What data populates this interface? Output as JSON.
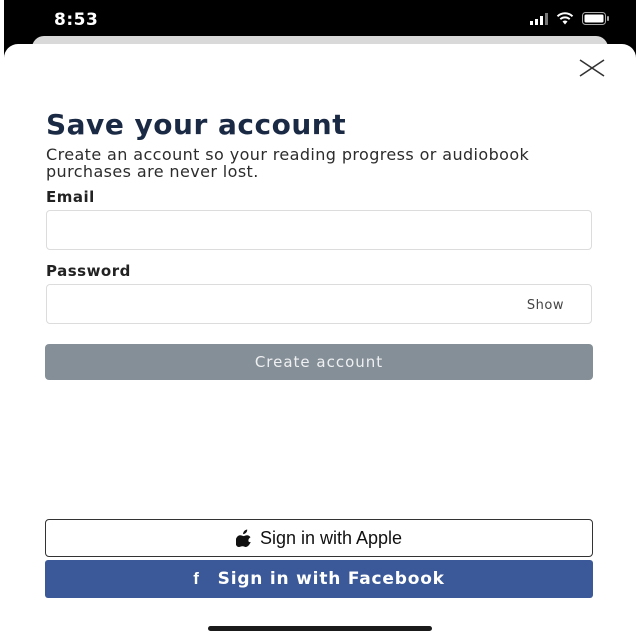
{
  "status_bar": {
    "time": "8:53"
  },
  "dialog": {
    "title": "Save your account",
    "subtitle": "Create an account so your reading progress or audiobook purchases are never lost.",
    "email_label": "Email",
    "email_value": "",
    "password_label": "Password",
    "password_value": "",
    "show_label": "Show",
    "create_button": "Create account",
    "apple_button": "Sign in with Apple",
    "facebook_icon_glyph": "f",
    "facebook_button": "Sign in with Facebook"
  },
  "icons": {
    "close": "close-icon",
    "apple": "apple-icon",
    "facebook": "facebook-icon",
    "signal": "signal-icon",
    "wifi": "wifi-icon",
    "battery": "battery-icon"
  },
  "colors": {
    "title": "#1b2a44",
    "create_button_disabled": "#858f97",
    "facebook": "#3b5998"
  }
}
